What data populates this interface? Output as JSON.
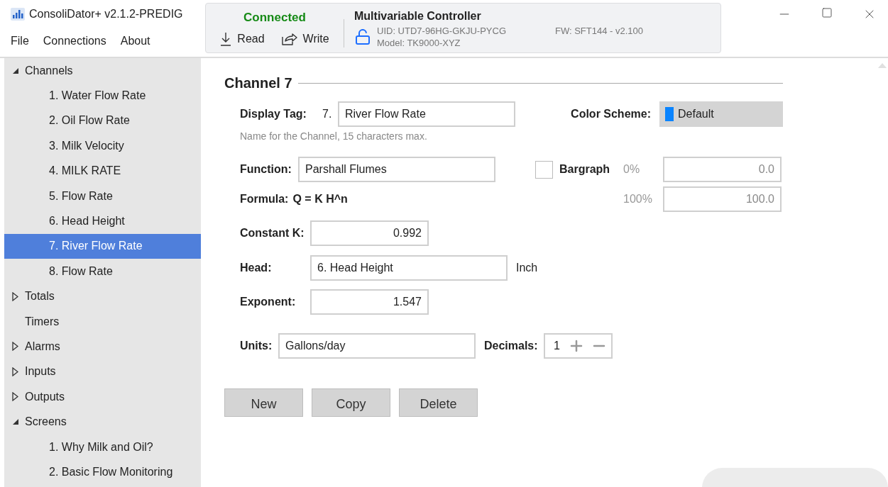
{
  "window": {
    "title": "ConsoliDator+ v2.1.2-PREDIG"
  },
  "menu": [
    "File",
    "Connections",
    "About"
  ],
  "connection": {
    "status": "Connected",
    "connected": true,
    "actions": [
      {
        "label": "Read",
        "kind": "read"
      },
      {
        "label": "Write",
        "kind": "write"
      }
    ]
  },
  "device": {
    "name": "Multivariable Controller",
    "locked": false,
    "uid": "UID: UTD7-96HG-GKJU-PYCG",
    "model": "Model: TK9000-XYZ",
    "firmware": "FW: SFT144 - v2.100"
  },
  "sidebar": {
    "items": [
      {
        "label": "Channels",
        "selected": false,
        "expanded": true,
        "children": [
          {
            "label": "1. Water Flow Rate",
            "selected": false
          },
          {
            "label": "2. Oil Flow Rate",
            "selected": false
          },
          {
            "label": "3. Milk Velocity",
            "selected": false
          },
          {
            "label": "4. MILK RATE",
            "selected": false
          },
          {
            "label": "5. Flow Rate",
            "selected": false
          },
          {
            "label": "6. Head Height",
            "selected": false
          },
          {
            "label": "7. River Flow Rate",
            "selected": true
          },
          {
            "label": "8. Flow Rate",
            "selected": false
          }
        ]
      },
      {
        "label": "Totals",
        "selected": false,
        "expanded": false
      },
      {
        "label": "Timers",
        "selected": false
      },
      {
        "label": "Alarms",
        "selected": false,
        "expanded": false
      },
      {
        "label": "Inputs",
        "selected": false,
        "expanded": false
      },
      {
        "label": "Outputs",
        "selected": false,
        "expanded": false
      },
      {
        "label": "Screens",
        "selected": false,
        "expanded": true,
        "children": [
          {
            "label": "1. Why Milk and Oil?",
            "selected": false
          },
          {
            "label": "2. Basic Flow Monitoring",
            "selected": false
          }
        ]
      }
    ]
  },
  "channel": {
    "title": "Channel 7",
    "display_tag": {
      "label": "Display Tag:",
      "prefix": "7.",
      "value": "River Flow Rate",
      "hint": "Name for the Channel, 15 characters max."
    },
    "color_scheme": {
      "label": "Color Scheme:",
      "value": "Default",
      "color": "#0a84ff"
    },
    "function": {
      "label": "Function:",
      "value": "Parshall Flumes"
    },
    "bargraph": {
      "label": "Bargraph",
      "checked": false,
      "min_label": "0%",
      "min_value": "0.0",
      "max_label": "100%",
      "max_value": "100.0"
    },
    "formula": {
      "label": "Formula:",
      "value": "Q = K H^n"
    },
    "constant_k": {
      "label": "Constant K:",
      "value": "0.992"
    },
    "head": {
      "label": "Head:",
      "value": "6. Head Height",
      "unit": "Inch"
    },
    "exponent": {
      "label": "Exponent:",
      "value": "1.547"
    },
    "units": {
      "label": "Units:",
      "value": "Gallons/day"
    },
    "decimals": {
      "label": "Decimals:",
      "value": "1"
    }
  },
  "buttons": [
    "New",
    "Copy",
    "Delete"
  ]
}
